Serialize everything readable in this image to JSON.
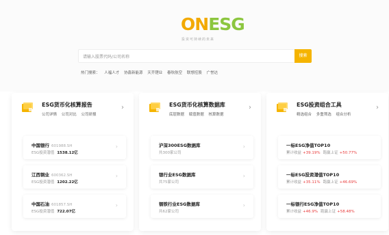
{
  "header": {
    "logo_on": "ON",
    "logo_esg": "ESG",
    "slogan": "投资可持续的未来"
  },
  "search": {
    "placeholder": "请输入股票代码/公司名称",
    "button": "搜索"
  },
  "hot": {
    "label": "热门搜索：",
    "terms": [
      "人福人才",
      "协鑫新能源",
      "天齐锂业",
      "春秋航空",
      "联想控股",
      "广誉达"
    ]
  },
  "cards": [
    {
      "title": "ESG货币化核算报告",
      "subs": [
        "公司详情",
        "公司对比",
        "公司研报"
      ],
      "items": [
        {
          "name": "中国银行",
          "code": "601988.SH",
          "label": "ESG投资潜值",
          "value": "1538.12亿"
        },
        {
          "name": "江西铜业",
          "code": "600362.SH",
          "label": "ESG投资潜值",
          "value": "1202.22亿"
        },
        {
          "name": "中国石油",
          "code": "601857.SH",
          "label": "ESG投资潜值",
          "value": "722.07亿"
        }
      ]
    },
    {
      "title": "ESG货币化核算数据库",
      "subs": [
        "底层数据",
        "赋值数据",
        "核算数据"
      ],
      "items": [
        {
          "name": "沪深300ESG数据库",
          "sub": "共300家公司"
        },
        {
          "name": "银行业ESG数据库",
          "sub": "共75家公司"
        },
        {
          "name": "钢铁行业ESG数据库",
          "sub": "共62家公司"
        }
      ]
    },
    {
      "title": "ESG投资组合工具",
      "subs": [
        "精选组合",
        "多重筛选",
        "组合分析"
      ],
      "items": [
        {
          "name": "一标ESG净值TOP10",
          "l1": "累计收益",
          "v1": "+39.19%",
          "l2": "跑赢上证",
          "v2": "+50.77%"
        },
        {
          "name": "一标ESG投资潜值TOP10",
          "l1": "累计收益",
          "v1": "+35.11%",
          "l2": "跑赢上证",
          "v2": "+46.69%"
        },
        {
          "name": "一标银行ESG净值TOP10",
          "l1": "累计收益",
          "v1": "+46.9%",
          "l2": "跑赢上证",
          "v2": "+58.48%"
        }
      ]
    }
  ],
  "colors": {
    "brand_orange": "#f5b400",
    "brand_green": "#8cc63f",
    "positive_red": "#e83a3a"
  }
}
